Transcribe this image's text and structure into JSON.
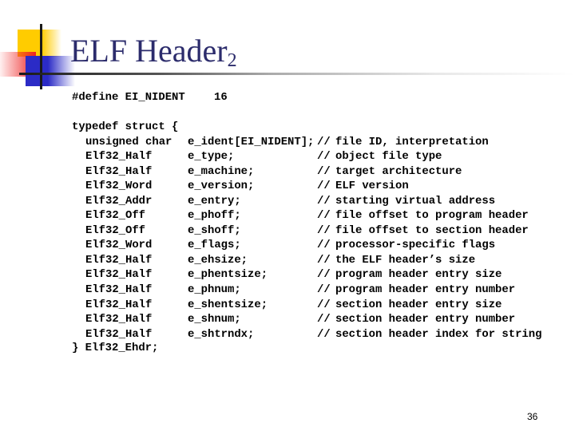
{
  "title": {
    "text": "ELF Header",
    "subscript": "2"
  },
  "code": {
    "define_line": "#define EI_NIDENT",
    "define_value": "16",
    "typedef_open": "typedef struct {",
    "members": [
      {
        "type": "unsigned char",
        "field": "e_ident[EI_NIDENT];",
        "slash": "//",
        "comment": "file ID, interpretation"
      },
      {
        "type": "Elf32_Half",
        "field": "e_type;",
        "slash": "//",
        "comment": "object file type"
      },
      {
        "type": "Elf32_Half",
        "field": "e_machine;",
        "slash": "//",
        "comment": "target architecture"
      },
      {
        "type": "Elf32_Word",
        "field": "e_version;",
        "slash": "//",
        "comment": "ELF version"
      },
      {
        "type": "Elf32_Addr",
        "field": "e_entry;",
        "slash": "//",
        "comment": "starting virtual address"
      },
      {
        "type": "Elf32_Off",
        "field": "e_phoff;",
        "slash": "//",
        "comment": "file offset to program header"
      },
      {
        "type": "Elf32_Off",
        "field": "e_shoff;",
        "slash": "//",
        "comment": "file offset to section header"
      },
      {
        "type": "Elf32_Word",
        "field": "e_flags;",
        "slash": "//",
        "comment": "processor-specific flags"
      },
      {
        "type": "Elf32_Half",
        "field": "e_ehsize;",
        "slash": "//",
        "comment": "the ELF header’s size"
      },
      {
        "type": "Elf32_Half",
        "field": "e_phentsize;",
        "slash": "//",
        "comment": "program header entry size"
      },
      {
        "type": "Elf32_Half",
        "field": "e_phnum;",
        "slash": "//",
        "comment": "program header entry number"
      },
      {
        "type": "Elf32_Half",
        "field": "e_shentsize;",
        "slash": "//",
        "comment": "section header entry size"
      },
      {
        "type": "Elf32_Half",
        "field": "e_shnum;",
        "slash": "//",
        "comment": "section header entry number"
      },
      {
        "type": "Elf32_Half",
        "field": "e_shtrndx;",
        "slash": "//",
        "comment": "section header index for string"
      }
    ],
    "typedef_close": "} Elf32_Ehdr;"
  },
  "page_number": "36",
  "colors": {
    "title": "#2c2c6c",
    "accent_yellow": "#ffcc00",
    "accent_blue": "#2b2bc6",
    "accent_red": "#ee2222"
  }
}
